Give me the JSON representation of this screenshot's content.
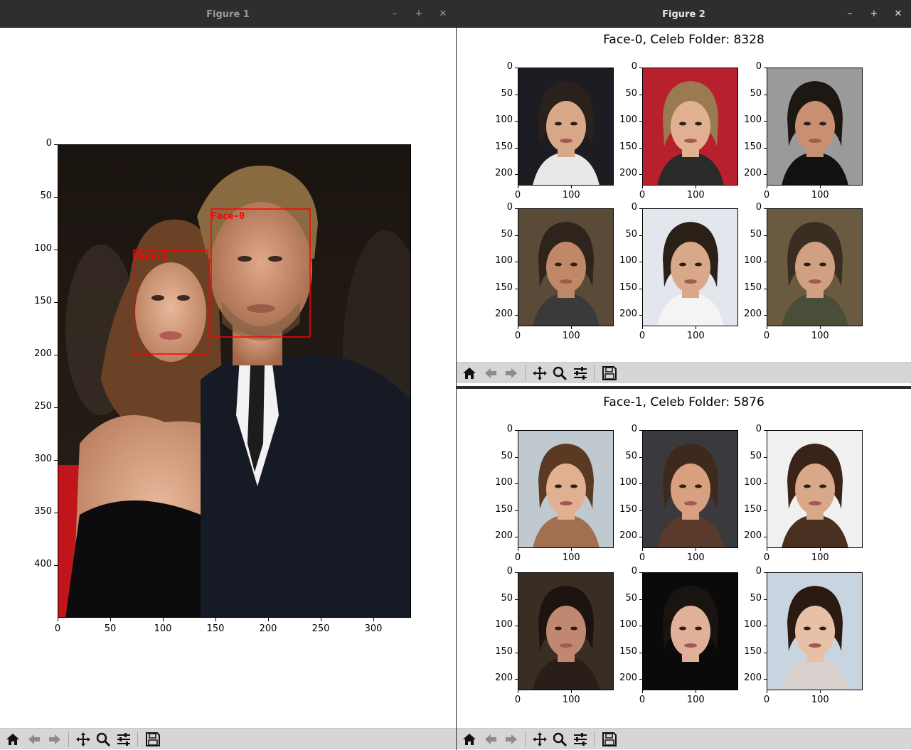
{
  "figure1": {
    "title": "Figure 1",
    "window_buttons": [
      "–",
      "+",
      "✕"
    ],
    "yticks": [
      "0",
      "50",
      "100",
      "150",
      "200",
      "250",
      "300",
      "350",
      "400"
    ],
    "xticks": [
      "0",
      "50",
      "100",
      "150",
      "200",
      "250",
      "300"
    ],
    "boxes": [
      {
        "label": "Face-0",
        "color": "#ff0000"
      },
      {
        "label": "Face-1",
        "color": "#ff0000"
      }
    ]
  },
  "figure2": {
    "title": "Figure 2",
    "window_buttons": [
      "–",
      "+",
      "✕"
    ],
    "panels": [
      {
        "title": "Face-0, Celeb Folder: 8328"
      },
      {
        "title": "Face-1, Celeb Folder: 5876"
      }
    ],
    "yticks": [
      "0",
      "50",
      "100",
      "150",
      "200"
    ],
    "xticks": [
      "0",
      "100"
    ]
  },
  "toolbar": {
    "items": [
      {
        "name": "home-icon",
        "tooltip": "home"
      },
      {
        "name": "back-icon",
        "tooltip": "back"
      },
      {
        "name": "forward-icon",
        "tooltip": "forward"
      },
      {
        "name": "pan-icon",
        "tooltip": "pan"
      },
      {
        "name": "zoom-icon",
        "tooltip": "zoom"
      },
      {
        "name": "configure-subplots-icon",
        "tooltip": "subplots"
      },
      {
        "name": "save-icon",
        "tooltip": "save"
      }
    ]
  },
  "colors": {
    "titlebar": "#2e2e2e",
    "toolbar": "#d6d6d6",
    "box": "#ff0000"
  }
}
